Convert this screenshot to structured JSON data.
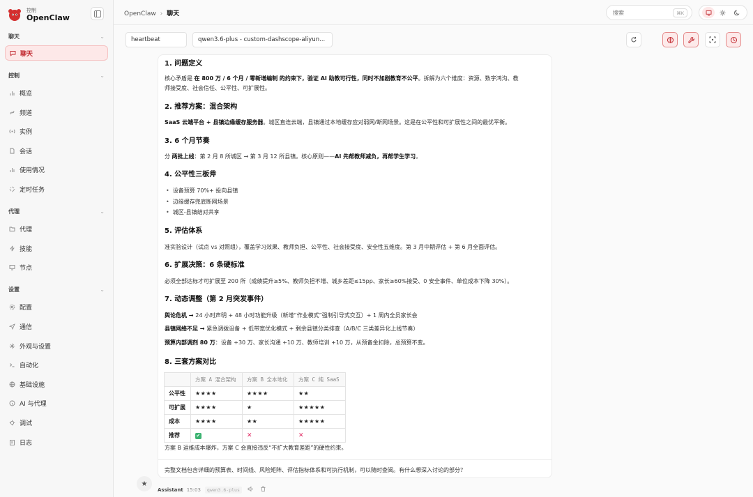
{
  "brand": {
    "small": "控制",
    "name": "OpenClaw"
  },
  "sidebar": {
    "sections": [
      {
        "label": "聊天",
        "items": [
          {
            "label": "聊天",
            "icon": "chat-icon",
            "active": true
          }
        ]
      },
      {
        "label": "控制",
        "items": [
          {
            "label": "概览",
            "icon": "bar-chart-icon"
          },
          {
            "label": "频道",
            "icon": "link-icon"
          },
          {
            "label": "实例",
            "icon": "radio-icon"
          },
          {
            "label": "会话",
            "icon": "document-icon"
          },
          {
            "label": "使用情况",
            "icon": "bar-chart-icon"
          },
          {
            "label": "定时任务",
            "icon": "loader-icon"
          }
        ]
      },
      {
        "label": "代理",
        "items": [
          {
            "label": "代理",
            "icon": "folder-icon"
          },
          {
            "label": "技能",
            "icon": "zap-icon"
          },
          {
            "label": "节点",
            "icon": "monitor-icon"
          }
        ]
      },
      {
        "label": "设置",
        "items": [
          {
            "label": "配置",
            "icon": "gear-icon"
          },
          {
            "label": "通信",
            "icon": "send-icon"
          },
          {
            "label": "外观与设置",
            "icon": "sparkle-icon"
          },
          {
            "label": "自动化",
            "icon": "terminal-icon"
          },
          {
            "label": "基础设施",
            "icon": "globe-icon"
          },
          {
            "label": "AI 与代理",
            "icon": "info-icon"
          },
          {
            "label": "调试",
            "icon": "bug-icon"
          },
          {
            "label": "日志",
            "icon": "clipboard-icon"
          }
        ]
      }
    ]
  },
  "topbar": {
    "breadcrumb_root": "OpenClaw",
    "breadcrumb_sep": "›",
    "breadcrumb_current": "聊天",
    "search_placeholder": "搜索",
    "search_shortcut": "⌘K"
  },
  "toolbar": {
    "session": "heartbeat",
    "model": "qwen3.6-plus - custom-dashscope-aliyun..."
  },
  "message": {
    "h1": "1. 问题定义",
    "p1_a": "核心矛盾是 ",
    "p1_b": "在 800 万 / 6 个月 / 零新增编制 的约束下，验证 AI 助教可行性，同时不加剧教育不公平",
    "p1_c": "。拆解为六个维度：资源、数字鸿沟、教",
    "p1_d": "师接受度、社会信任、公平性、可扩展性。",
    "h2": "2. 推荐方案：混合架构",
    "p2_a": "SaaS 云端平台 + 县镇边缘缓存服务器",
    "p2_b": "。城区直连云端，县镇通过本地缓存应对弱网/断网场景。这是在公平性和可扩展性之间的最优平衡。",
    "h3": "3. 6 个月节奏",
    "p3_a": "分 ",
    "p3_b": "两批上线",
    "p3_c": "：第 2 月 8 所城区 → 第 3 月 12 所县镇。核心原则——",
    "p3_d": "AI 先帮教师减负，再帮学生学习",
    "p3_e": "。",
    "h4": "4. 公平性三板斧",
    "list4": [
      "设备预算 70%+ 投向县镇",
      "边缘缓存兜底断网场景",
      "城区-县镇结对共享"
    ],
    "h5": "5. 评估体系",
    "p5": "准实验设计（试点 vs 对照组），覆盖学习效果、教师负担、公平性、社会接受度、安全性五维度。第 3 月中期评估 + 第 6 月全面评估。",
    "h6": "6. 扩展决策：6 条硬标准",
    "p6": "必须全部达标才可扩展至 200 所（成绩提升≥5%、教师负担不增、城乡差距≤15pp、家长≥60%接受、0 安全事件、单位成本下降 30%）。",
    "h7": "7. 动态调整（第 2 月突发事件）",
    "p7a_b": "舆论危机 → ",
    "p7a": "24 小时声明 + 48 小时功能升级（新增“作业模式”强制引导式交互）+ 1 周内全员家长会",
    "p7b_b": "县镇网络不足 → ",
    "p7b": "紧急调拨设备 + 低带宽优化模式 + 剩余县镇分类排查（A/B/C 三类差异化上线节奏）",
    "p7c_b": "预算内部调剂 80 万",
    "p7c": "：设备 +30 万、家长沟通 +10 万、教师培训 +10 万，从预备金扣除，总预算不变。",
    "h8": "8. 三套方案对比",
    "table": {
      "headers": [
        "",
        "方案 A 混合架构",
        "方案 B 全本地化",
        "方案 C 纯 SaaS"
      ],
      "rows": [
        {
          "label": "公平性",
          "cells": [
            "★★★★",
            "★★★★",
            "★★"
          ]
        },
        {
          "label": "可扩展",
          "cells": [
            "★★★★",
            "★",
            "★★★★★"
          ]
        },
        {
          "label": "成本",
          "cells": [
            "★★★★",
            "★★",
            "★★★★★"
          ]
        },
        {
          "label": "推荐",
          "cells": [
            "✔",
            "✕",
            "✕"
          ]
        }
      ]
    },
    "note": "方案 B 运维成本爆炸，方案 C 会直接违反“不扩大教育差距”的硬性约束。",
    "closing": "完整文档包含详细的预算表、时间线、风险矩阵、评估指标体系和可执行机制，可以随时查阅。有什么想深入讨论的部分？"
  },
  "footer": {
    "role": "Assistant",
    "time": "15:03",
    "model": "qwen3.6-plus"
  },
  "colors": {
    "accent": "#c0262d",
    "accent_bg": "#fde8e8"
  }
}
